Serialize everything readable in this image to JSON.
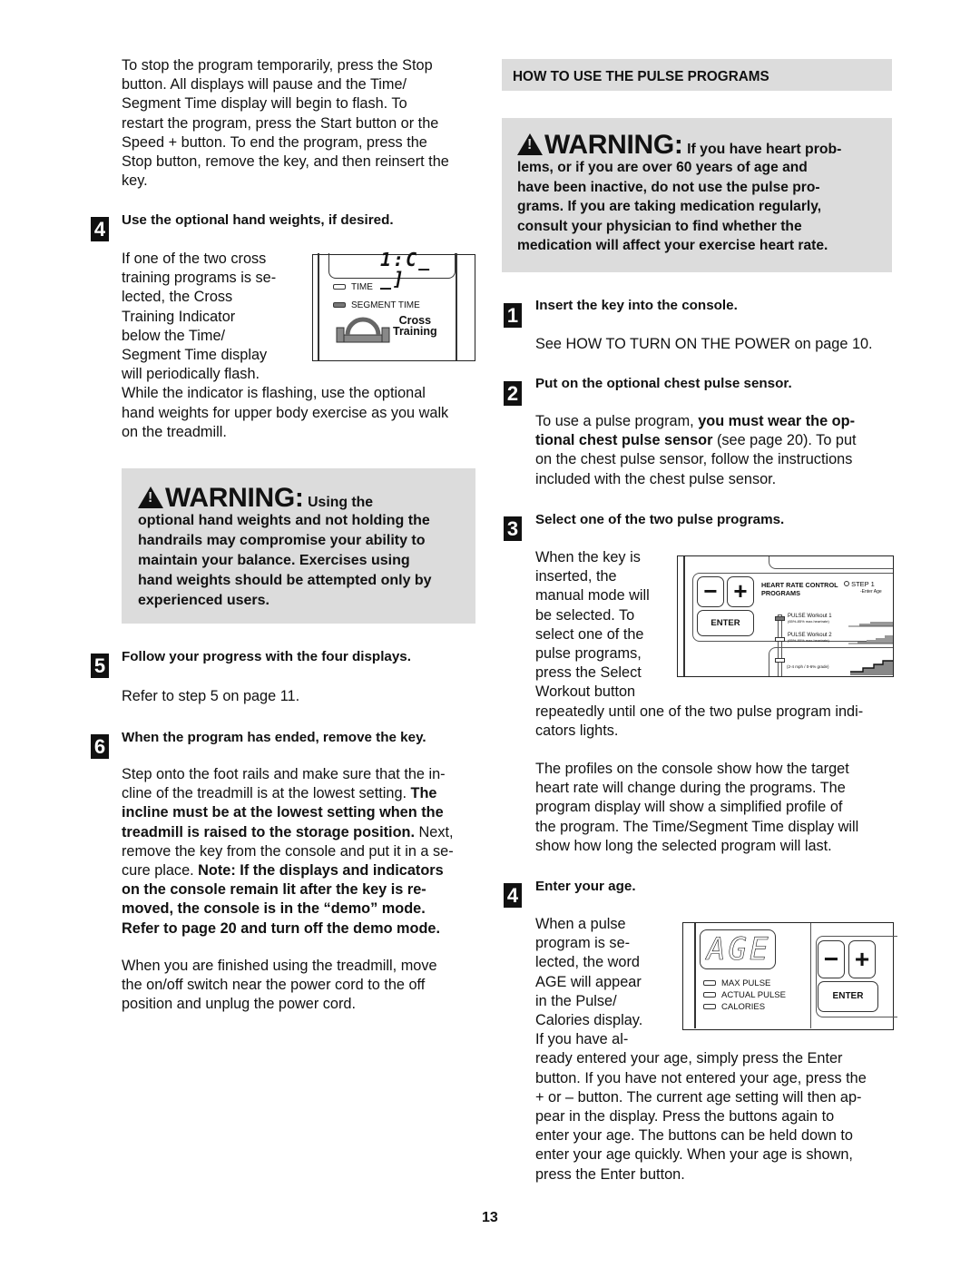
{
  "page_number": "13",
  "left_column": {
    "intro_lines": [
      "To stop the program temporarily, press the Stop",
      "button. All displays will pause and the Time/",
      "Segment Time display will begin to flash. To",
      "restart the program, press the Start button or the",
      "Speed + button. To end the program, press the",
      "Stop button, remove the key, and then reinsert the",
      "key."
    ],
    "step4": {
      "number": "4",
      "heading": "Use the optional hand weights, if desired.",
      "wrap_lines": [
        "If one of the two cross",
        "training programs is se-",
        "lected, the Cross",
        "Training Indicator",
        "below the Time/",
        "Segment Time display",
        "will periodically flash."
      ],
      "after_lines": [
        "While the indicator is flashing, use the optional",
        "hand weights for upper body exercise as you walk",
        "on the treadmill."
      ],
      "console": {
        "lcd_value": "1:C_ _]",
        "indicators": [
          {
            "label": "TIME",
            "lit": false
          },
          {
            "label": "SEGMENT TIME",
            "lit": true
          }
        ],
        "cross_training_line1": "Cross",
        "cross_training_line2": "Training"
      }
    },
    "warning": {
      "title": "WARNING:",
      "subtitle": "Using the",
      "lines": [
        "optional hand weights and not holding the",
        "handrails may compromise your ability to",
        "maintain your balance. Exercises using",
        "hand weights should be attempted only by",
        "experienced users."
      ]
    },
    "step5": {
      "number": "5",
      "heading": "Follow your progress with the four displays.",
      "body": "Refer to step 5 on page 11."
    },
    "step6": {
      "number": "6",
      "heading": "When the program has ended, remove the key.",
      "para1_lines": [
        [
          {
            "t": "Step onto the foot rails and make sure that the in-",
            "b": false
          }
        ],
        [
          {
            "t": "cline of the treadmill is at the lowest setting. ",
            "b": false
          },
          {
            "t": "The",
            "b": true
          }
        ],
        [
          {
            "t": "incline must be at the lowest setting when the",
            "b": true
          }
        ],
        [
          {
            "t": "treadmill is raised to the storage position.",
            "b": true
          },
          {
            "t": " Next,",
            "b": false
          }
        ],
        [
          {
            "t": "remove the key from the console and put it in a se-",
            "b": false
          }
        ],
        [
          {
            "t": "cure place. ",
            "b": false
          },
          {
            "t": "Note: If the displays and indicators",
            "b": true
          }
        ],
        [
          {
            "t": "on the console remain lit after the key is re-",
            "b": true
          }
        ],
        [
          {
            "t": "moved, the console is in the “demo” mode.",
            "b": true
          }
        ],
        [
          {
            "t": "Refer to page 20 and turn off the demo mode.",
            "b": true
          }
        ]
      ],
      "para2_lines": [
        "When you are finished using the treadmill, move",
        "the on/off switch near the power cord to the off",
        "position and unplug the power cord."
      ]
    }
  },
  "right_column": {
    "section_title": "HOW TO USE THE PULSE PROGRAMS",
    "warning": {
      "title": "WARNING:",
      "subtitle": "If you have heart prob-",
      "lines": [
        "lems, or if you are over 60 years of age and",
        "have been inactive, do not use the pulse pro-",
        "grams. If you are taking medication regularly,",
        "consult your physician to find whether the",
        "medication will affect your exercise heart rate."
      ]
    },
    "step1": {
      "number": "1",
      "heading": "Insert the key into the console.",
      "body": "See HOW TO TURN ON THE POWER on page 10."
    },
    "step2": {
      "number": "2",
      "heading": "Put on the optional chest pulse sensor.",
      "lines": [
        [
          {
            "t": "To use a pulse program, ",
            "b": false
          },
          {
            "t": "you must wear the op-",
            "b": true
          }
        ],
        [
          {
            "t": "tional chest pulse sensor",
            "b": true
          },
          {
            "t": " (see page 20). To put",
            "b": false
          }
        ],
        [
          {
            "t": "on the chest pulse sensor, follow the instructions",
            "b": false
          }
        ],
        [
          {
            "t": "included with the chest pulse sensor.",
            "b": false
          }
        ]
      ]
    },
    "step3": {
      "number": "3",
      "heading": "Select one of the two pulse programs.",
      "wrap_lines": [
        "When the key is",
        "inserted, the",
        "manual mode will",
        "be selected. To",
        "select one of the",
        "pulse programs,",
        "press the Select",
        "Workout button"
      ],
      "after_lines": [
        "repeatedly until one of the two pulse program indi-",
        "cators lights."
      ],
      "para2_lines": [
        "The profiles on the console show how the target",
        "heart rate will change during the programs. The",
        "program display will show a simplified profile of",
        "the program. The Time/Segment Time display will",
        "show how long the selected program will last."
      ],
      "console": {
        "minus": "−",
        "plus": "+",
        "enter": "ENTER",
        "hrc_title_1": "HEART RATE CONTROL",
        "hrc_title_2": "PROGRAMS",
        "step_label": "STEP 1",
        "step_sub": "-Enter Age",
        "workout1_name": "PULSE Workout 1",
        "workout1_range": "(65%-85% max.heartrate)",
        "workout2_name": "PULSE Workout 2",
        "workout2_range": "(65%-80% max.heartrate)",
        "manual_range": "(2-4 mph / 0-6% grade)"
      }
    },
    "step4": {
      "number": "4",
      "heading": "Enter your age.",
      "wrap_lines": [
        "When a pulse",
        "program is se-",
        "lected, the word",
        "AGE will appear",
        "in the Pulse/",
        "Calories display.",
        "If you have al-"
      ],
      "after_lines": [
        "ready entered your age, simply press the Enter",
        "button. If you have not entered your age, press the",
        "+ or – button. The current age setting will then ap-",
        "pear in the display. Press the buttons again to",
        "enter your age. The buttons can be held down to",
        "enter your age quickly. When your age is shown,",
        "press the Enter button."
      ],
      "console": {
        "lcd_value": "AGE",
        "indicators": [
          "MAX PULSE",
          "ACTUAL PULSE",
          "CALORIES"
        ],
        "minus": "−",
        "plus": "+",
        "enter": "ENTER"
      }
    }
  }
}
